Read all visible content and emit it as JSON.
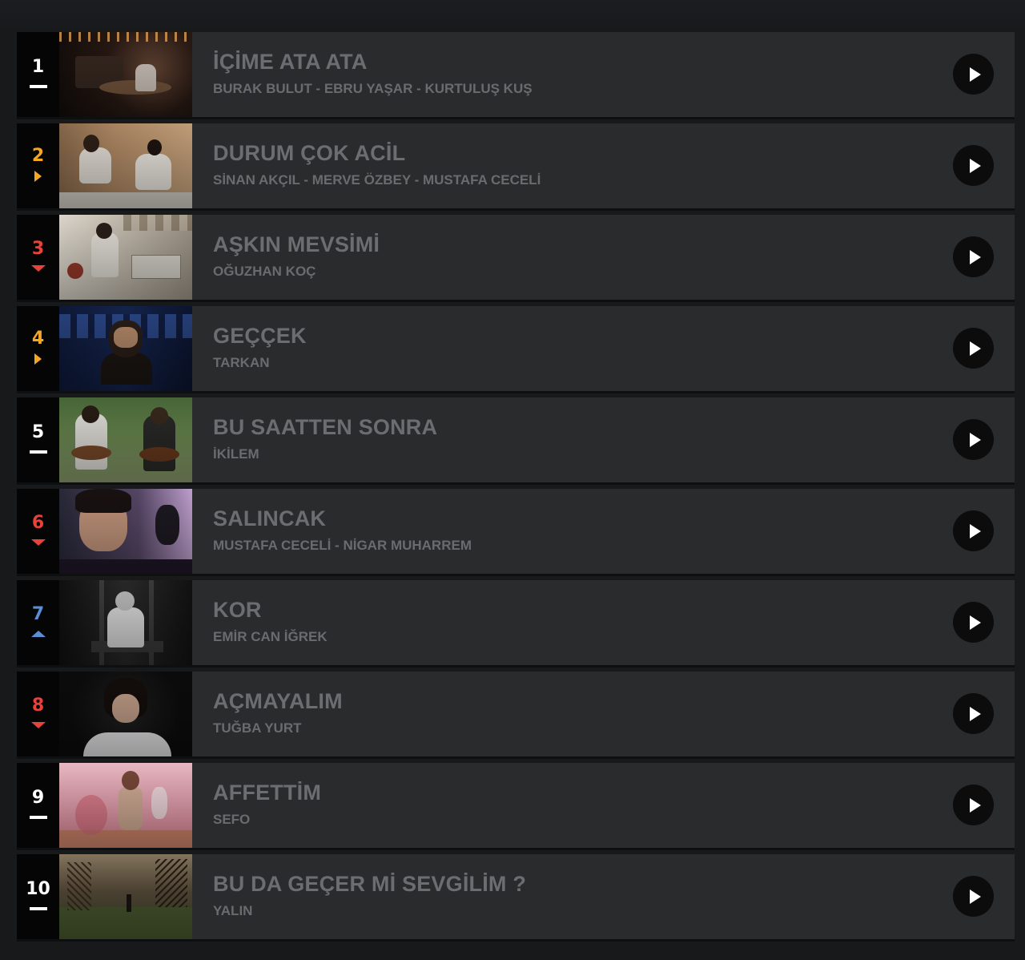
{
  "chart": {
    "entries": [
      {
        "rank": "1",
        "trend": "same",
        "title": "İÇİME ATA ATA",
        "artist": "BURAK BULUT - EBRU YAŞAR - KURTULUŞ KUŞ",
        "rank_color": "#ffffff"
      },
      {
        "rank": "2",
        "trend": "right",
        "title": "DURUM ÇOK ACİL",
        "artist": "SİNAN AKÇIL - MERVE ÖZBEY - MUSTAFA CECELİ",
        "rank_color": "#f5a623"
      },
      {
        "rank": "3",
        "trend": "down",
        "title": "AŞKIN MEVSİMİ",
        "artist": "OĞUZHAN KOÇ",
        "rank_color": "#e8423a"
      },
      {
        "rank": "4",
        "trend": "right",
        "title": "GEÇÇEK",
        "artist": "TARKAN",
        "rank_color": "#f5a623"
      },
      {
        "rank": "5",
        "trend": "same",
        "title": "BU SAATTEN SONRA",
        "artist": "İKİLEM",
        "rank_color": "#ffffff"
      },
      {
        "rank": "6",
        "trend": "down",
        "title": "SALINCAK",
        "artist": "MUSTAFA CECELİ - NİGAR MUHARREM",
        "rank_color": "#e8423a"
      },
      {
        "rank": "7",
        "trend": "up",
        "title": "KOR",
        "artist": "EMİR CAN İĞREK",
        "rank_color": "#5a8fd6"
      },
      {
        "rank": "8",
        "trend": "down",
        "title": "AÇMAYALIM",
        "artist": "TUĞBA YURT",
        "rank_color": "#e8423a"
      },
      {
        "rank": "9",
        "trend": "same",
        "title": "AFFETTİM",
        "artist": "SEFO",
        "rank_color": "#ffffff"
      },
      {
        "rank": "10",
        "trend": "same",
        "title": "BU DA GEÇER Mİ SEVGİLİM ?",
        "artist": "YALIN",
        "rank_color": "#ffffff"
      }
    ]
  },
  "colors": {
    "background": "#18191b",
    "row_bg": "#2a2b2d",
    "rank_bg": "#050506",
    "text_muted": "#6c6d70",
    "trend_up": "#5a8fd6",
    "trend_down": "#e8423a",
    "trend_right": "#f5a623",
    "trend_same": "#ffffff"
  },
  "icons": {
    "play": "play-icon",
    "trend_same": "dash-icon",
    "trend_right": "triangle-right-icon",
    "trend_down": "triangle-down-icon",
    "trend_up": "triangle-up-icon"
  }
}
